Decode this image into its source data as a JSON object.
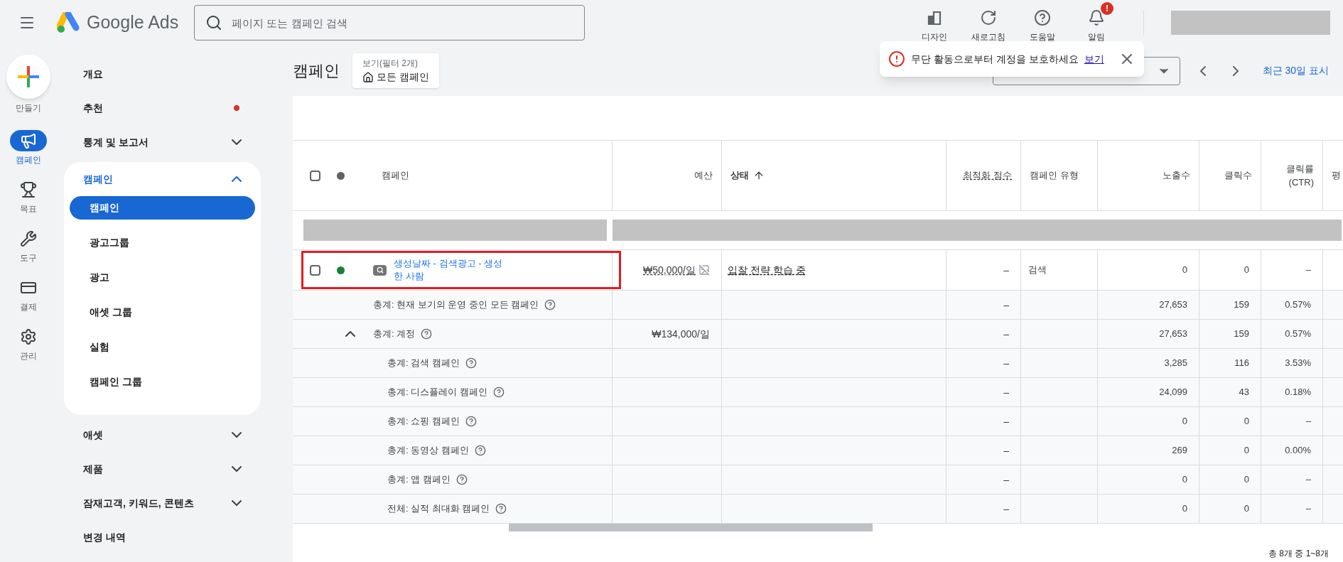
{
  "header": {
    "product_name": "Google Ads",
    "search": {
      "placeholder": "페이지 또는 캠페인 검색"
    },
    "tools": [
      {
        "label": "디자인",
        "kind": "design"
      },
      {
        "label": "새로고침",
        "kind": "refresh"
      },
      {
        "label": "도움말",
        "kind": "help"
      },
      {
        "label": "알림",
        "kind": "alerts",
        "badge": "!"
      }
    ]
  },
  "rail": {
    "create_label": "만들기",
    "items": [
      {
        "label": "캠페인",
        "kind": "campaigns",
        "selected": true
      },
      {
        "label": "목표",
        "kind": "goals",
        "selected": false
      },
      {
        "label": "도구",
        "kind": "tools",
        "selected": false
      },
      {
        "label": "결제",
        "kind": "billing",
        "selected": false
      },
      {
        "label": "관리",
        "kind": "admin",
        "selected": false
      }
    ]
  },
  "sidebar": {
    "items": [
      {
        "label": "개요",
        "has_notice": false
      },
      {
        "label": "추천",
        "has_notice": true
      },
      {
        "label": "통계 및 보고서",
        "has_notice": false,
        "expanded": false
      },
      {
        "label": "캠페인",
        "has_notice": false,
        "expanded": true,
        "children": [
          {
            "label": "캠페인",
            "selected": true
          },
          {
            "label": "광고그룹",
            "selected": false
          },
          {
            "label": "광고",
            "selected": false
          },
          {
            "label": "애셋 그룹",
            "selected": false
          },
          {
            "label": "실험",
            "selected": false
          },
          {
            "label": "캠페인 그룹",
            "selected": false
          }
        ]
      },
      {
        "label": "애셋",
        "has_notice": false,
        "expanded": false
      },
      {
        "label": "제품",
        "has_notice": false,
        "expanded": false
      },
      {
        "label": "잠재고객, 키워드, 콘텐츠",
        "has_notice": false,
        "expanded": false
      },
      {
        "label": "변경 내역",
        "has_notice": false
      }
    ]
  },
  "page": {
    "title": "캠페인",
    "view": {
      "label": "보기(필터 2개)",
      "value": "모든 캠페인"
    },
    "toast": {
      "message": "무단 활동으로부터 계정을 보호하세요",
      "link": "보기"
    },
    "date_range": {
      "label": "최근 30일 표시"
    }
  },
  "table": {
    "select_all_checked": false,
    "columns": [
      {
        "lines": [
          "캠페인"
        ],
        "sorted": false,
        "dotted": false
      },
      {
        "lines": [
          "예산"
        ],
        "sorted": false,
        "dotted": false
      },
      {
        "lines": [
          "상태"
        ],
        "sorted": true,
        "dotted": false
      },
      {
        "lines": [
          "최적화 점수"
        ],
        "sorted": false,
        "dotted": true
      },
      {
        "lines": [
          "캠페인 유형"
        ],
        "sorted": false,
        "dotted": false
      },
      {
        "lines": [
          "노출수"
        ],
        "sorted": false,
        "dotted": false
      },
      {
        "lines": [
          "클릭수"
        ],
        "sorted": false,
        "dotted": false
      },
      {
        "lines": [
          "클릭률",
          "(CTR)"
        ],
        "sorted": false,
        "dotted": false
      },
      {
        "lines": [
          "평"
        ],
        "sorted": false,
        "dotted": false
      }
    ],
    "rows": [
      {
        "kind": "redacted"
      },
      {
        "kind": "campaign",
        "checked": false,
        "highlighted": true,
        "color": "#188038",
        "name": "생성날짜 - 검색광고 - 생성 한 사람",
        "budget": "₩50,000/일",
        "status": "입찰 전략 학습 중",
        "optimization_score": "–",
        "campaign_type": "검색",
        "impressions": "0",
        "clicks": "0",
        "ctr": "–"
      },
      {
        "kind": "total",
        "label": "총계: 현재 보기의 운영 중인 모든 캠페인",
        "optimization_score": "–",
        "impressions": "27,653",
        "clicks": "159",
        "ctr": "0.57%"
      },
      {
        "kind": "total",
        "label": "총계: 계정",
        "expanded": true,
        "budget": "₩134,000/일",
        "optimization_score": "–",
        "impressions": "27,653",
        "clicks": "159",
        "ctr": "0.57%",
        "children": [
          {
            "kind": "total",
            "label": "총계: 검색 캠페인",
            "optimization_score": "–",
            "impressions": "3,285",
            "clicks": "116",
            "ctr": "3.53%"
          },
          {
            "kind": "total",
            "label": "총계: 디스플레이 캠페인",
            "optimization_score": "–",
            "impressions": "24,099",
            "clicks": "43",
            "ctr": "0.18%"
          },
          {
            "kind": "total",
            "label": "총계: 쇼핑 캠페인",
            "optimization_score": "–",
            "impressions": "0",
            "clicks": "0",
            "ctr": "–"
          },
          {
            "kind": "total",
            "label": "총계: 동영상 캠페인",
            "optimization_score": "–",
            "impressions": "269",
            "clicks": "0",
            "ctr": "0.00%"
          },
          {
            "kind": "total",
            "label": "총계: 앱 캠페인",
            "optimization_score": "–",
            "impressions": "0",
            "clicks": "0",
            "ctr": "–"
          },
          {
            "kind": "total",
            "label": "전체: 실적 최대화 캠페인",
            "optimization_score": "–",
            "impressions": "0",
            "clicks": "0",
            "ctr": "–"
          }
        ]
      }
    ]
  },
  "footer": {
    "pagination": "총 8개 중 1~8개"
  }
}
